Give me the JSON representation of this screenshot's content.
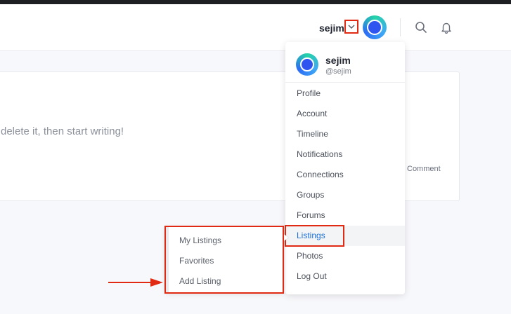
{
  "header": {
    "username": "sejim",
    "icons": {
      "chevron": "chevron-down-icon",
      "search": "search-icon",
      "notifications": "bell-icon"
    }
  },
  "content": {
    "editor_hint": "delete it, then start writing!",
    "comment_label": "Comment"
  },
  "user_menu": {
    "name": "sejim",
    "handle": "@sejim",
    "items": [
      {
        "label": "Profile"
      },
      {
        "label": "Account"
      },
      {
        "label": "Timeline"
      },
      {
        "label": "Notifications"
      },
      {
        "label": "Connections"
      },
      {
        "label": "Groups"
      },
      {
        "label": "Forums"
      },
      {
        "label": "Listings"
      },
      {
        "label": "Photos"
      },
      {
        "label": "Log Out"
      }
    ],
    "active_item": "Listings"
  },
  "listings_submenu": {
    "items": [
      {
        "label": "My Listings"
      },
      {
        "label": "Favorites"
      },
      {
        "label": "Add Listing"
      }
    ]
  },
  "colors": {
    "annotation": "#e02a14",
    "active_link": "#1c6fd6"
  }
}
